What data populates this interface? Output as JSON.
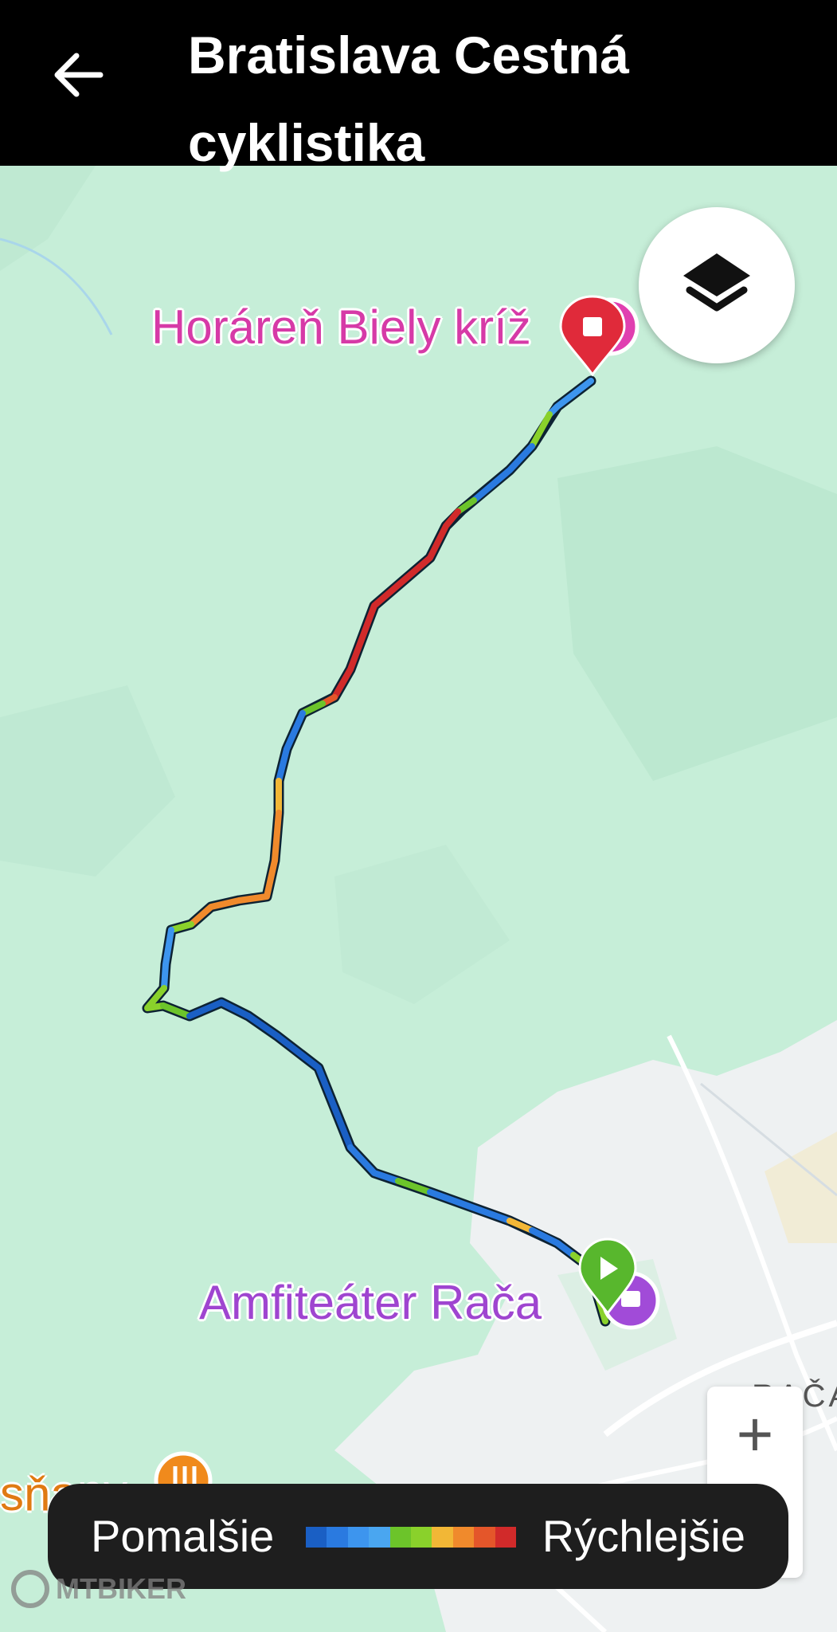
{
  "header": {
    "title": "Bratislava Cestná cyklistika",
    "back_icon": "arrow-left-icon"
  },
  "map": {
    "poi_top": "Horáreň Biely kríž",
    "poi_bottom": "Amfiteáter Rača",
    "place_right": "RAČA",
    "place_left": "sňany",
    "layers_icon": "layers-icon",
    "zoom_in_label": "+",
    "start_icon": "play-icon",
    "end_icon": "stop-icon"
  },
  "legend": {
    "slow_label": "Pomalšie",
    "fast_label": "Rýchlejšie",
    "colors": [
      "#1a5fc4",
      "#2a7ae0",
      "#3d95ee",
      "#4aa6f0",
      "#6cc42a",
      "#8ad12b",
      "#f2b736",
      "#f08a2c",
      "#e4562a",
      "#d12a2a"
    ]
  },
  "watermark": {
    "text": "MTBIKER"
  }
}
